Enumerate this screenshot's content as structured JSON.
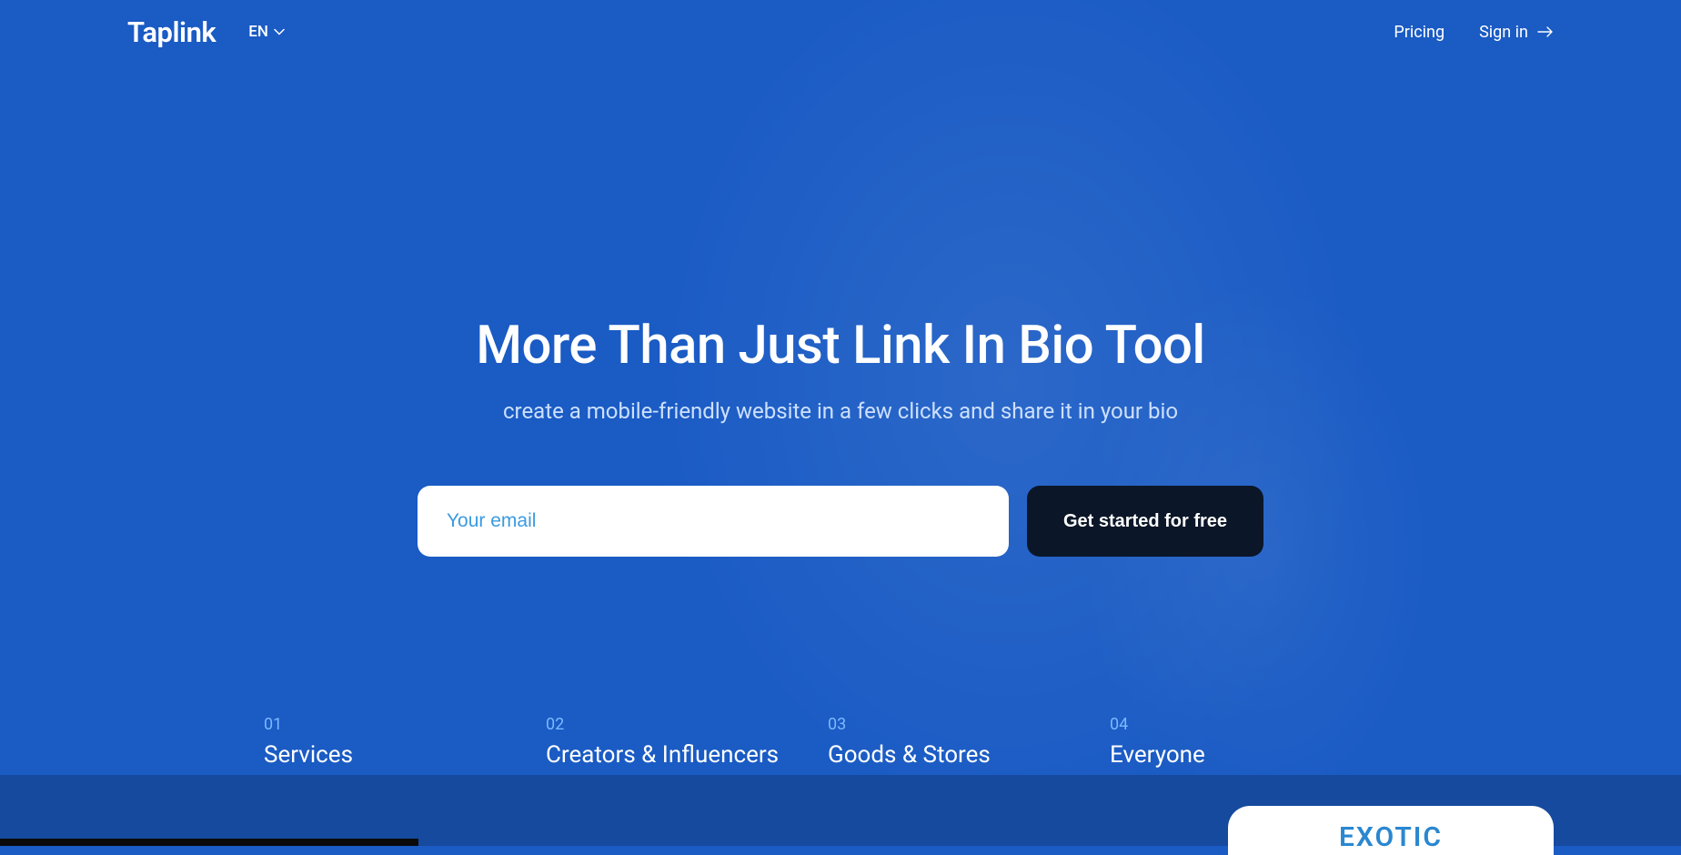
{
  "header": {
    "logo": "Taplink",
    "lang": "EN",
    "pricing": "Pricing",
    "signin": "Sign in"
  },
  "hero": {
    "title": "More Than Just Link In Bio Tool",
    "subtitle": "create a mobile-friendly website in a few clicks and share it in your bio",
    "email_placeholder": "Your email",
    "cta": "Get started for free"
  },
  "tabs": [
    {
      "num": "01",
      "label": "Services"
    },
    {
      "num": "02",
      "label": "Creators & Influencers"
    },
    {
      "num": "03",
      "label": "Goods & Stores"
    },
    {
      "num": "04",
      "label": "Everyone"
    }
  ],
  "card": {
    "exotic": "EXOTIC"
  }
}
